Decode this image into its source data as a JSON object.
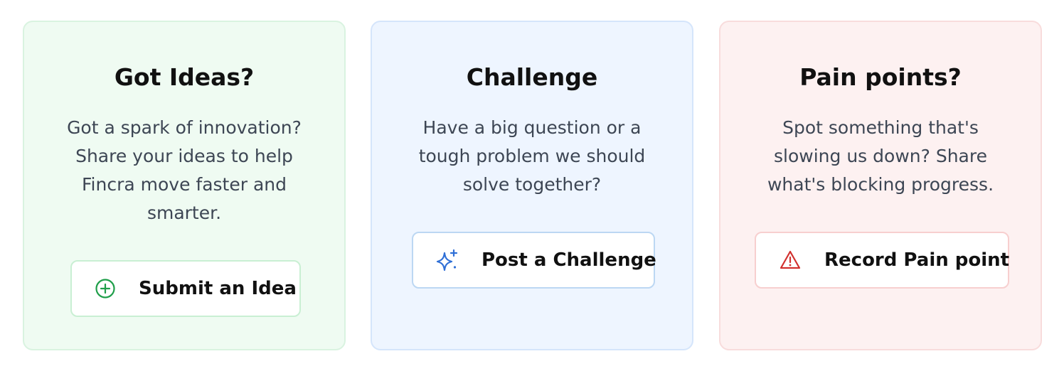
{
  "cards": [
    {
      "title": "Got Ideas?",
      "description": "Got a spark of innovation? Share your ideas to help Fincra move faster and smarter.",
      "button_label": "Submit an Idea",
      "icon": "plus-circle-icon",
      "accent": "#1e9e49"
    },
    {
      "title": "Challenge",
      "description": "Have a big question or a tough problem we should solve together?",
      "button_label": "Post a Challenge",
      "icon": "sparkles-icon",
      "accent": "#2f6fd6"
    },
    {
      "title": "Pain points?",
      "description": "Spot something that's slowing us down? Share what's blocking progress.",
      "button_label": "Record Pain point",
      "icon": "warning-triangle-icon",
      "accent": "#d2312f"
    }
  ]
}
